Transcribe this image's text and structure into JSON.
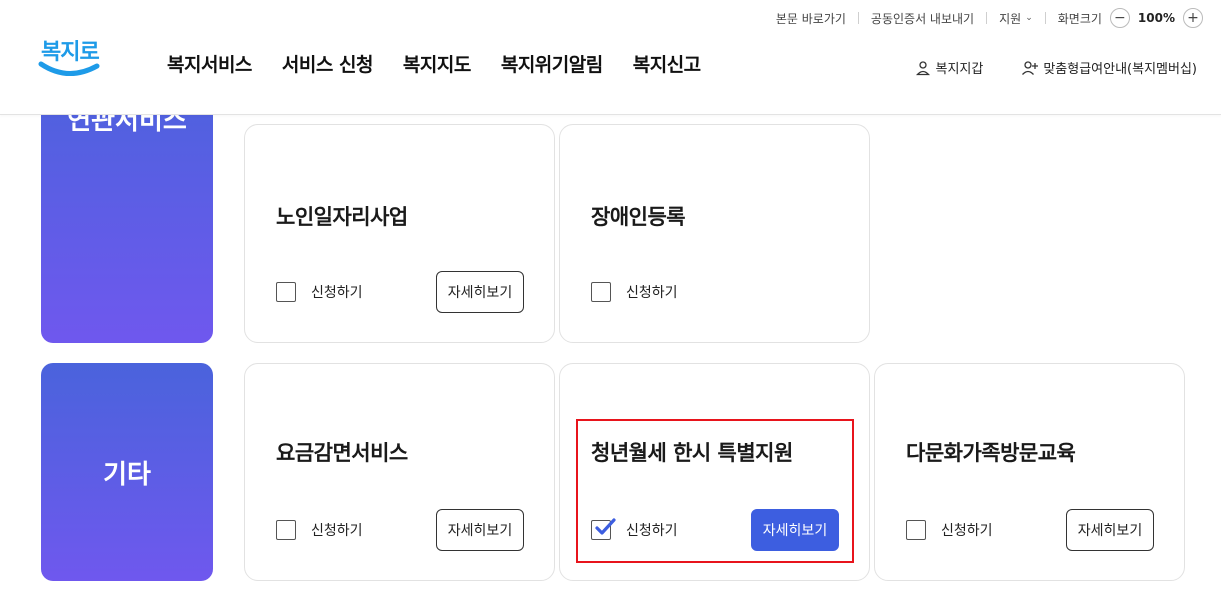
{
  "util": {
    "skip_link": "본문 바로가기",
    "cert_export": "공동인증서 내보내기",
    "support": "지원",
    "zoom_label": "화면크기",
    "zoom_minus": "−",
    "zoom_value": "100%",
    "zoom_plus": "+"
  },
  "logo": {
    "text": "복지로"
  },
  "gnb": [
    "복지서비스",
    "서비스 신청",
    "복지지도",
    "복지위기알림",
    "복지신고"
  ],
  "quick": {
    "wallet": "복지지갑",
    "membership": "맞춤형급여안내(복지멤버십)"
  },
  "categories": {
    "top": "연관서비스",
    "bottom": "기타"
  },
  "cards": [
    {
      "title": "노인일자리사업",
      "apply_label": "신청하기",
      "detail_label": "자세히보기",
      "checked": false
    },
    {
      "title": "장애인등록",
      "apply_label": "신청하기",
      "checked": false
    },
    {
      "title": "요금감면서비스",
      "apply_label": "신청하기",
      "detail_label": "자세히보기",
      "checked": false
    },
    {
      "title": "청년월세 한시 특별지원",
      "apply_label": "신청하기",
      "detail_label": "자세히보기",
      "checked": true
    },
    {
      "title": "다문화가족방문교육",
      "apply_label": "신청하기",
      "detail_label": "자세히보기",
      "checked": false
    }
  ],
  "colors": {
    "accent": "#3d5ee0",
    "category_gradient_start": "#4a63dc",
    "category_gradient_end": "#6f58ee",
    "highlight": "#e8141c",
    "logo": "#1e9be8"
  }
}
